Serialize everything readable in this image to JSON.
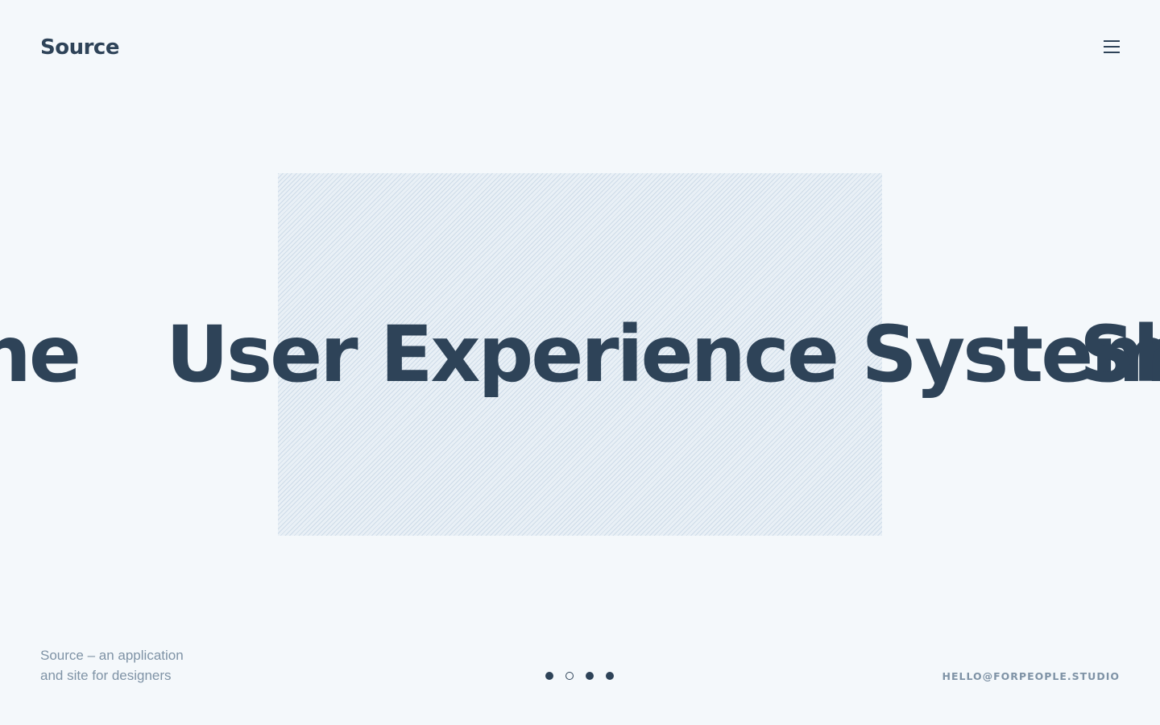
{
  "header": {
    "logo": "Source",
    "menu_icon": "hamburger-menu-icon"
  },
  "carousel": {
    "prev_word": "ne",
    "current_word": "User Experience System",
    "next_word": "Sh",
    "dots": [
      {
        "state": "filled"
      },
      {
        "state": "hollow"
      },
      {
        "state": "filled"
      },
      {
        "state": "filled"
      }
    ]
  },
  "footer": {
    "tagline_line1": "Source – an application",
    "tagline_line2": "and site for designers",
    "email": "HELLO@FORPEOPLE.STUDIO"
  },
  "colors": {
    "background": "#f4f8fb",
    "text_primary": "#2e4358",
    "text_muted": "#7f93a6"
  }
}
